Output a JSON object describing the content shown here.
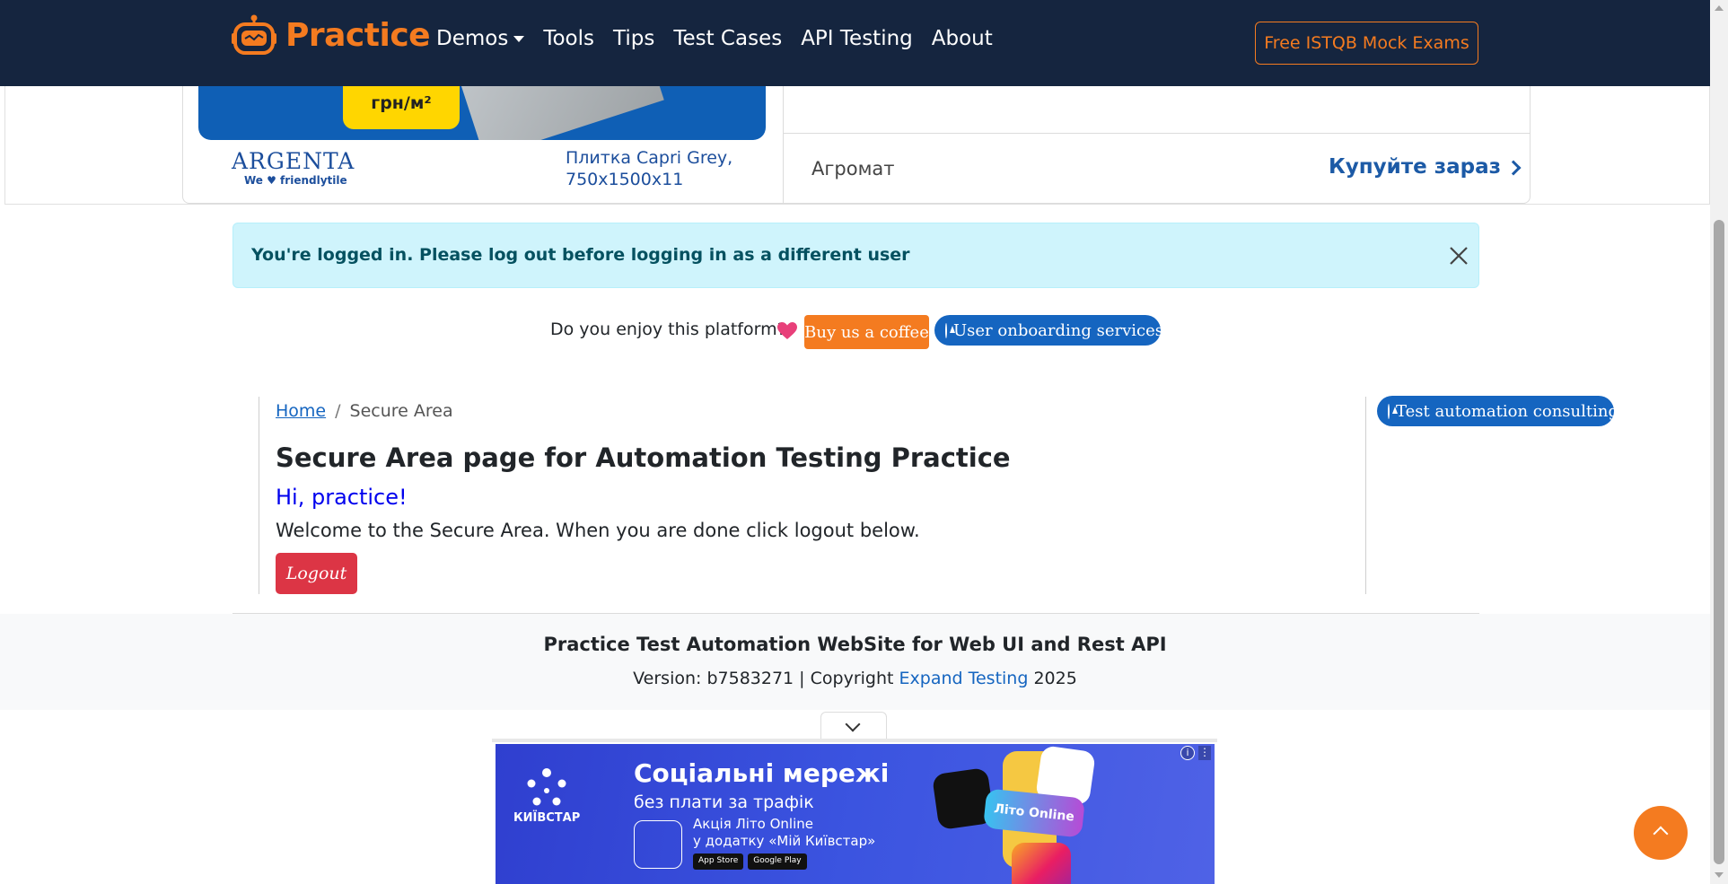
{
  "navbar": {
    "brand": "Practice",
    "links": [
      "Demos",
      "Tools",
      "Tips",
      "Test Cases",
      "API Testing",
      "About"
    ],
    "cta": "Free ISTQB Mock Exams",
    "brand_color": "#f47b20",
    "bg_color": "#15253f"
  },
  "ad_top": {
    "price": "грн/м²",
    "brand_name": "ARGENTA",
    "brand_tagline": "We ♥ friendlytile",
    "product_line1": "Плитка Capri Grey,",
    "product_line2": "750x1500x11",
    "seller": "Агромат",
    "buy_label": "Купуйте зараз"
  },
  "alert": {
    "text": "You're logged in. Please log out before logging in as a different user",
    "close_icon": "close-icon"
  },
  "enjoy": {
    "text": "Do you enjoy this platform?",
    "heart_icon": "heart-icon",
    "coffee_button": "Buy us a coffee",
    "onboarding_button": "User onboarding services"
  },
  "consulting_button": "Test automation consulting",
  "breadcrumb": {
    "home": "Home",
    "current": "Secure Area"
  },
  "main": {
    "title": "Secure Area page for Automation Testing Practice",
    "greeting": "Hi, practice!",
    "welcome": "Welcome to the Secure Area. When you are done click logout below.",
    "logout_button": "Logout"
  },
  "footer": {
    "title": "Practice Test Automation WebSite for Web UI and Rest API",
    "version_prefix": "Version: b7583271 | Copyright ",
    "link": "Expand Testing",
    "year": " 2025"
  },
  "ad_bottom": {
    "brand": "КИЇВСТАР",
    "headline": "Соціальні мережі",
    "subheadline": "без плати за трафік",
    "promo_line1": "Акція Літо Online",
    "promo_line2": "у додатку «Мій Київстар»",
    "store1": "App Store",
    "store2": "Google Play",
    "tile_label": "Літо Online",
    "info": "i",
    "more": "⋮"
  }
}
